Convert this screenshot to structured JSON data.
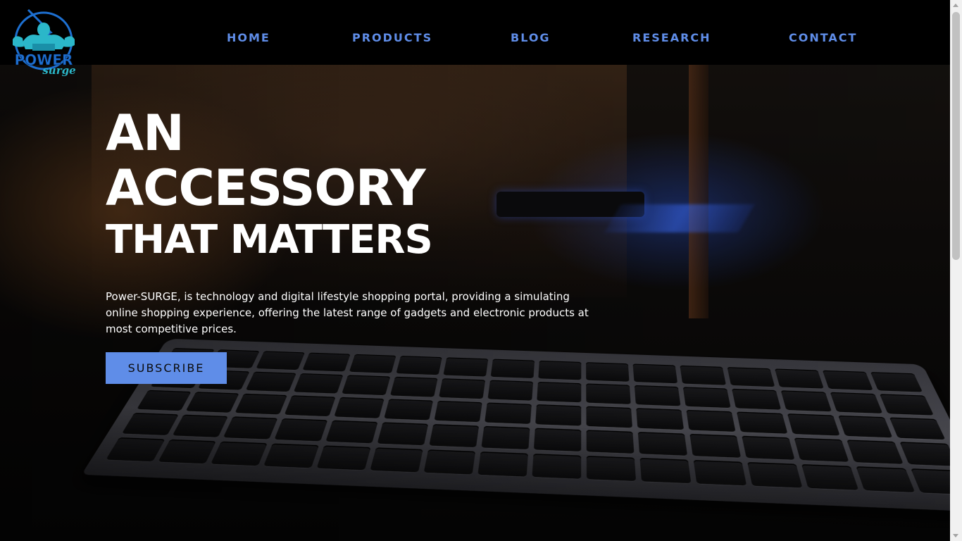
{
  "brand": {
    "logo_word_top": "POWER",
    "logo_word_bottom": "surge",
    "logo_colors": {
      "primary": "#1d6fd0",
      "accent": "#2bb7c9",
      "dark": "#0a1a3a"
    }
  },
  "nav": {
    "items": [
      {
        "label": "HOME"
      },
      {
        "label": "PRODUCTS"
      },
      {
        "label": "BLOG"
      },
      {
        "label": "RESEARCH"
      },
      {
        "label": "CONTACT"
      }
    ],
    "link_color": "#5f8de8"
  },
  "hero": {
    "headline_line1": "AN",
    "headline_line2": "ACCESSORY",
    "headline_line3": "THAT MATTERS",
    "description": "Power-SURGE, is technology and digital lifestyle shopping portal, providing a simulating online shopping experience, offering the latest range of gadgets and electronic products at most competitive prices.",
    "cta_label": "SUBSCRIBE",
    "cta_color": "#5f8de8",
    "background_image": "keyboard-photo"
  }
}
